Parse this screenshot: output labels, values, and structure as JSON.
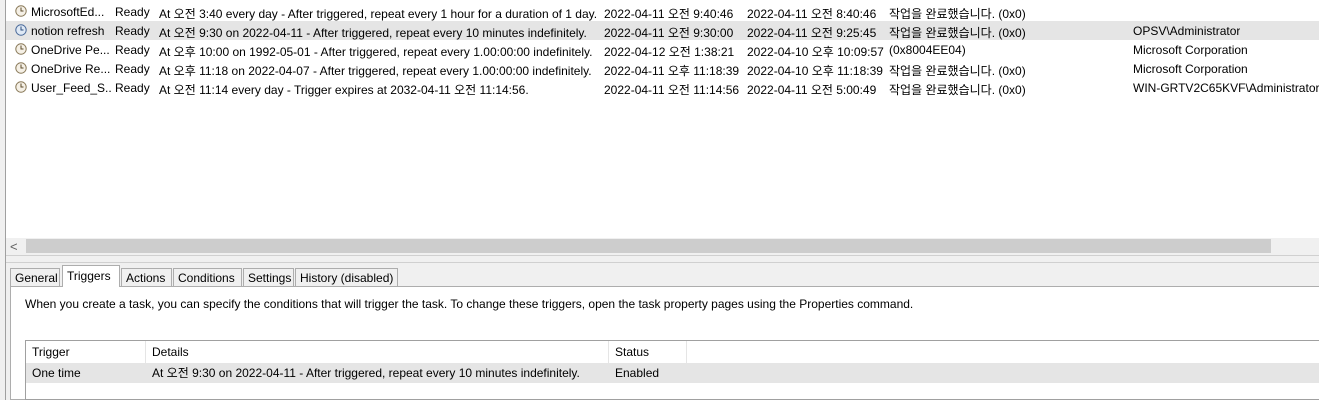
{
  "tasks": [
    {
      "name": "MicrosoftEd...",
      "status": "Ready",
      "triggers": "At 오전 3:40 every day - After triggered, repeat every 1 hour for a duration of 1 day.",
      "next_run": "2022-04-11 오전 9:40:46",
      "last_run": "2022-04-11 오전 8:40:46",
      "last_result": "작업을 완료했습니다. (0x0)",
      "author": ""
    },
    {
      "name": "notion refresh",
      "status": "Ready",
      "triggers": "At 오전 9:30 on 2022-04-11 - After triggered, repeat every 10 minutes indefinitely.",
      "next_run": "2022-04-11 오전 9:30:00",
      "last_run": "2022-04-11 오전 9:25:45",
      "last_result": "작업을 완료했습니다. (0x0)",
      "author": "OPSV\\Administrator"
    },
    {
      "name": "OneDrive Pe...",
      "status": "Ready",
      "triggers": "At 오후 10:00 on 1992-05-01 - After triggered, repeat every 1.00:00:00 indefinitely.",
      "next_run": "2022-04-12 오전 1:38:21",
      "last_run": "2022-04-10 오후 10:09:57",
      "last_result": "(0x8004EE04)",
      "author": "Microsoft Corporation"
    },
    {
      "name": "OneDrive Re...",
      "status": "Ready",
      "triggers": "At 오후 11:18 on 2022-04-07 - After triggered, repeat every 1.00:00:00 indefinitely.",
      "next_run": "2022-04-11 오후 11:18:39",
      "last_run": "2022-04-10 오후 11:18:39",
      "last_result": "작업을 완료했습니다. (0x0)",
      "author": "Microsoft Corporation"
    },
    {
      "name": "User_Feed_S...",
      "status": "Ready",
      "triggers": "At 오전 11:14 every day - Trigger expires at 2032-04-11 오전 11:14:56.",
      "next_run": "2022-04-11 오전 11:14:56",
      "last_run": "2022-04-11 오전 5:00:49",
      "last_result": "작업을 완료했습니다. (0x0)",
      "author": "WIN-GRTV2C65KVF\\Administrator"
    }
  ],
  "scroll_left_arrow": "<",
  "tabs": [
    {
      "label": "General"
    },
    {
      "label": "Triggers"
    },
    {
      "label": "Actions"
    },
    {
      "label": "Conditions"
    },
    {
      "label": "Settings"
    },
    {
      "label": "History (disabled)"
    }
  ],
  "triggers_panel": {
    "description": "When you create a task, you can specify the conditions that will trigger the task.  To change these triggers, open the task property pages using the Properties command.",
    "columns": {
      "trigger": "Trigger",
      "details": "Details",
      "status": "Status"
    },
    "rows": [
      {
        "trigger": "One time",
        "details": "At 오전 9:30 on 2022-04-11 - After triggered, repeat every 10 minutes indefinitely.",
        "status": "Enabled"
      }
    ]
  }
}
